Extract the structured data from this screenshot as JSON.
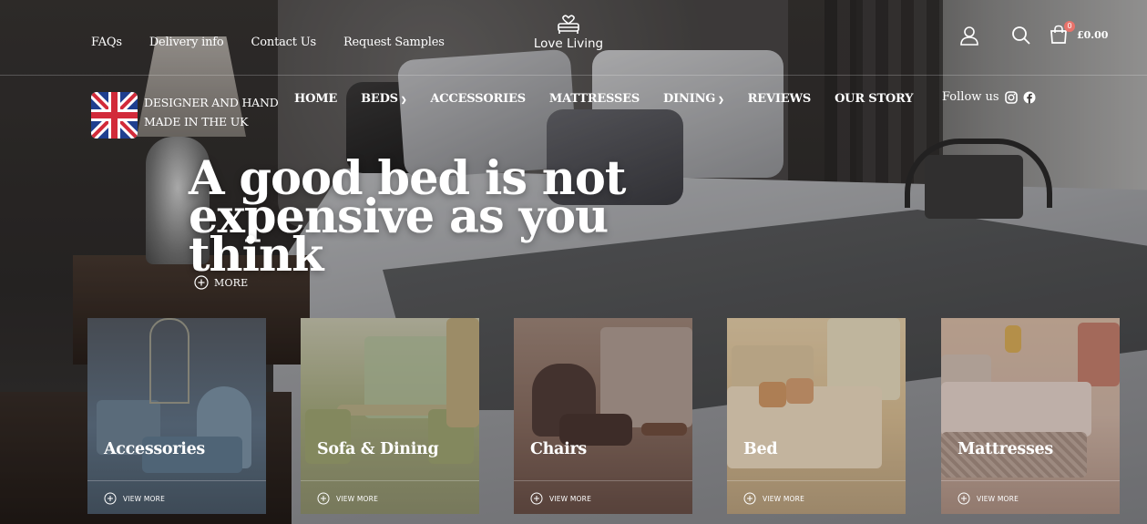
{
  "header": {
    "utility_links": [
      "FAQs",
      "Delivery info",
      "Contact Us",
      "Request Samples"
    ],
    "brand": "Love Living",
    "cart_count": "0",
    "cart_total": "£0.00"
  },
  "nav": {
    "tagline_line1": "DESIGNER AND HAND",
    "tagline_line2": "MADE IN THE UK",
    "items": [
      {
        "label": "HOME",
        "has_dropdown": false
      },
      {
        "label": "BEDS",
        "has_dropdown": true
      },
      {
        "label": "ACCESSORIES",
        "has_dropdown": false
      },
      {
        "label": "MATTRESSES",
        "has_dropdown": false
      },
      {
        "label": "DINING",
        "has_dropdown": true
      },
      {
        "label": "REVIEWS",
        "has_dropdown": false
      },
      {
        "label": "OUR STORY",
        "has_dropdown": false
      }
    ],
    "follow_label": "Follow us",
    "social_icons": [
      "instagram-icon",
      "facebook-icon"
    ]
  },
  "hero": {
    "headline_line1": "A good bed is not",
    "headline_line2": "expensive as you think",
    "more_label": "MORE"
  },
  "categories": [
    {
      "title": "Accessories",
      "cta": "VIEW MORE"
    },
    {
      "title": "Sofa & Dining",
      "cta": "VIEW MORE"
    },
    {
      "title": "Chairs",
      "cta": "VIEW MORE"
    },
    {
      "title": "Bed",
      "cta": "VIEW MORE"
    },
    {
      "title": "Mattresses",
      "cta": "VIEW MORE"
    }
  ],
  "colors": {
    "text": "#ffffff",
    "cart_badge": "#e8736b"
  }
}
